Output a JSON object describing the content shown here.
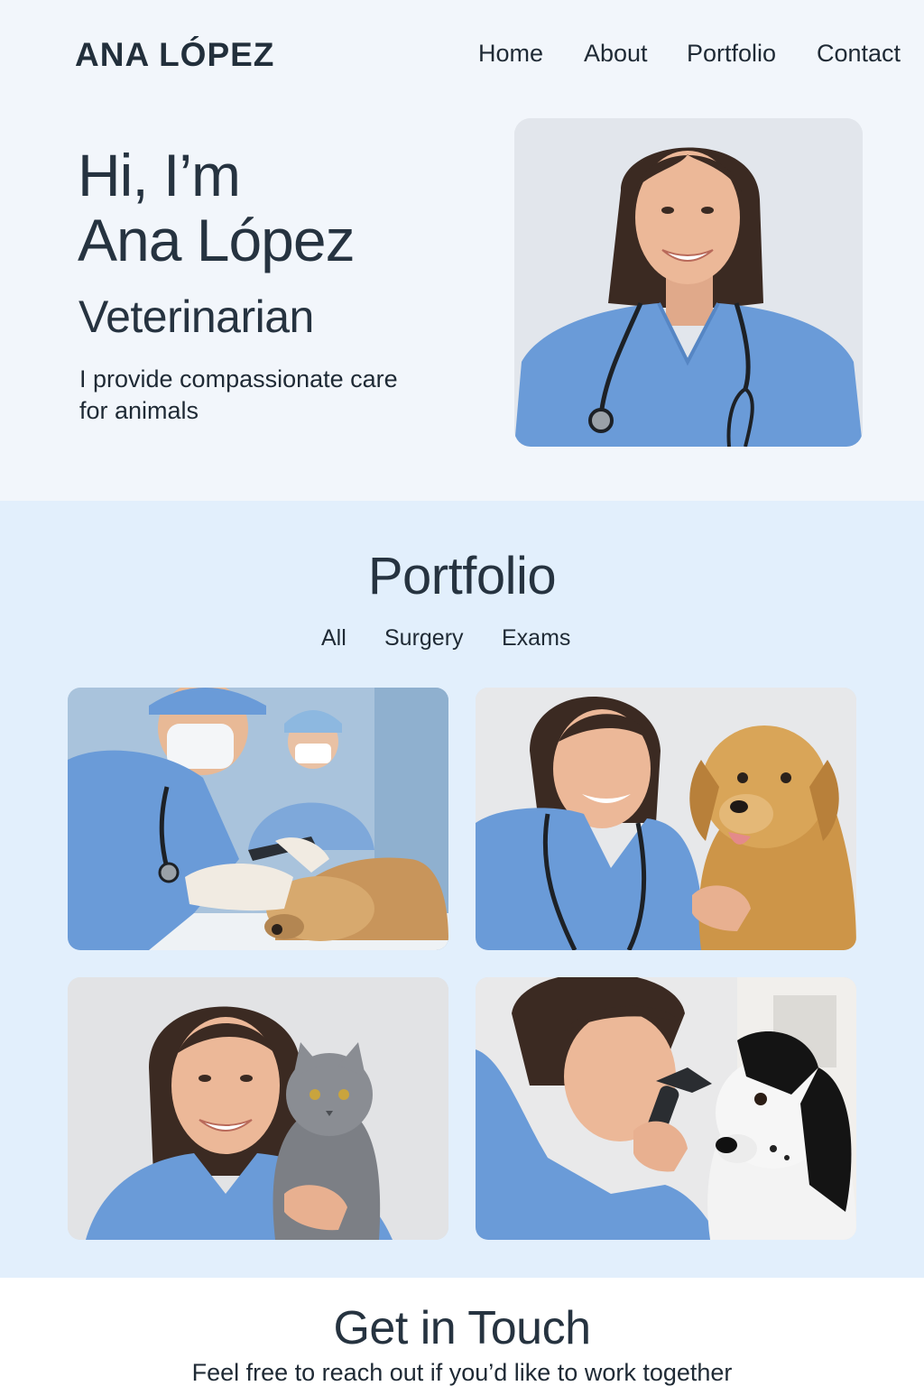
{
  "header": {
    "logo": "ANA LÓPEZ",
    "nav": [
      {
        "label": "Home"
      },
      {
        "label": "About"
      },
      {
        "label": "Portfolio"
      },
      {
        "label": "Contact"
      }
    ]
  },
  "hero": {
    "greeting_line1": "Hi, I’m",
    "greeting_line2": "Ana López",
    "role": "Veterinarian",
    "tagline": "I provide compassionate care for animals",
    "photo_alt": "Portrait of Ana López in blue scrubs with stethoscope"
  },
  "portfolio": {
    "title": "Portfolio",
    "filters": [
      {
        "label": "All"
      },
      {
        "label": "Surgery"
      },
      {
        "label": "Exams"
      }
    ],
    "items": [
      {
        "alt": "Surgeon treating a sedated dog"
      },
      {
        "alt": "Vet with a golden retriever"
      },
      {
        "alt": "Vet holding a gray cat"
      },
      {
        "alt": "Vet examining a dog's eye with an otoscope"
      }
    ]
  },
  "contact": {
    "title": "Get in Touch",
    "text": "Feel free to reach out if you’d like to work together"
  },
  "colors": {
    "hero_bg": "#f2f6fb",
    "portfolio_bg": "#e2effc",
    "scrubs": "#6a9bd8",
    "text": "#263340"
  }
}
